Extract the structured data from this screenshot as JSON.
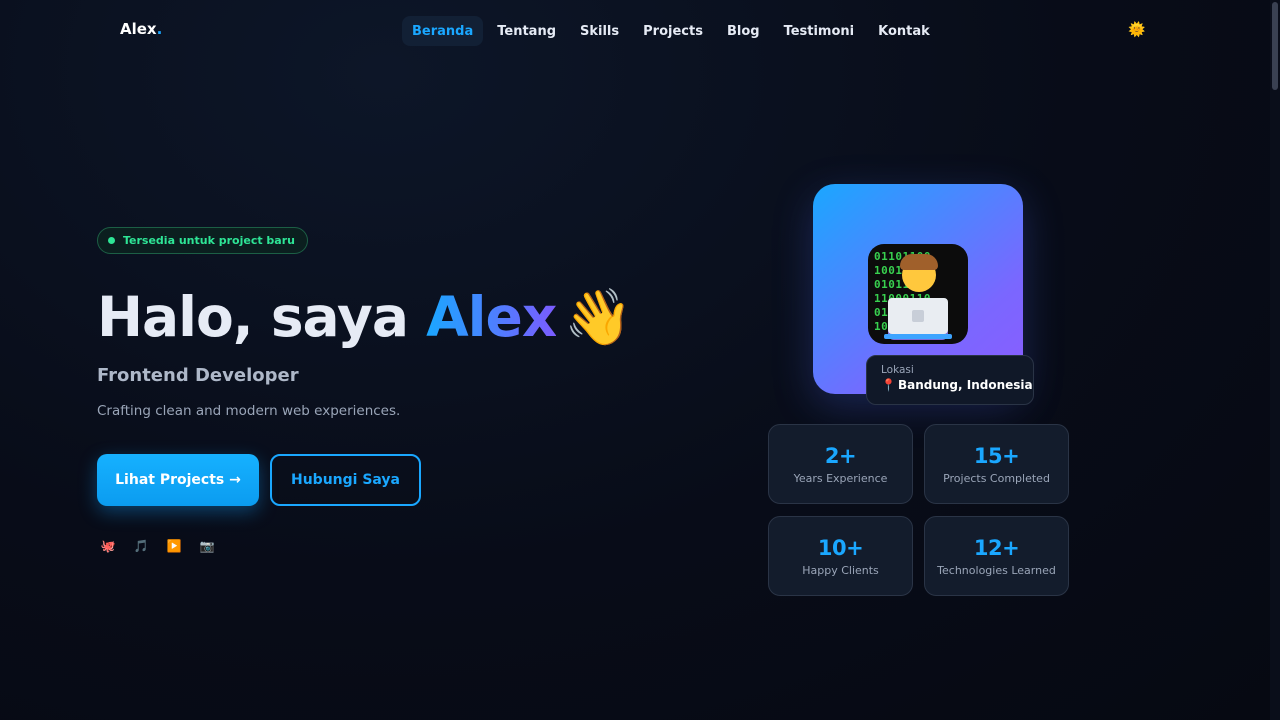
{
  "brand": {
    "name": "Alex",
    "dot": ".",
    "accent": "#1aa7ff",
    "gradient_end": "#7b5cff"
  },
  "nav": {
    "items": [
      {
        "label": "Beranda",
        "active": true
      },
      {
        "label": "Tentang"
      },
      {
        "label": "Skills"
      },
      {
        "label": "Projects"
      },
      {
        "label": "Blog"
      },
      {
        "label": "Testimoni"
      },
      {
        "label": "Kontak"
      }
    ],
    "theme_toggle_icon": "🌞"
  },
  "hero": {
    "badge": "Tersedia untuk project baru",
    "title_prefix": "Halo, saya ",
    "title_name": "Alex",
    "wave": "👋",
    "role": "Frontend Developer",
    "description": "Crafting clean and modern web experiences.",
    "primary_button": "Lihat Projects →",
    "secondary_button": "Hubungi Saya",
    "socials": [
      {
        "icon": "github-icon",
        "glyph": "🐙"
      },
      {
        "icon": "music-icon",
        "glyph": "🎵"
      },
      {
        "icon": "play-icon",
        "glyph": "▶️"
      },
      {
        "icon": "camera-icon",
        "glyph": "📷"
      }
    ]
  },
  "profile": {
    "avatar_icon": "technologist-icon",
    "location_label": "Lokasi",
    "location_pin": "📍",
    "location_value": "Bandung, Indonesia"
  },
  "stats": [
    {
      "number": "2",
      "suffix": "+",
      "label": "Years Experience"
    },
    {
      "number": "15",
      "suffix": "+",
      "label": "Projects Completed"
    },
    {
      "number": "10",
      "suffix": "+",
      "label": "Happy Clients"
    },
    {
      "number": "12",
      "suffix": "+",
      "label": "Technologies Learned"
    }
  ]
}
